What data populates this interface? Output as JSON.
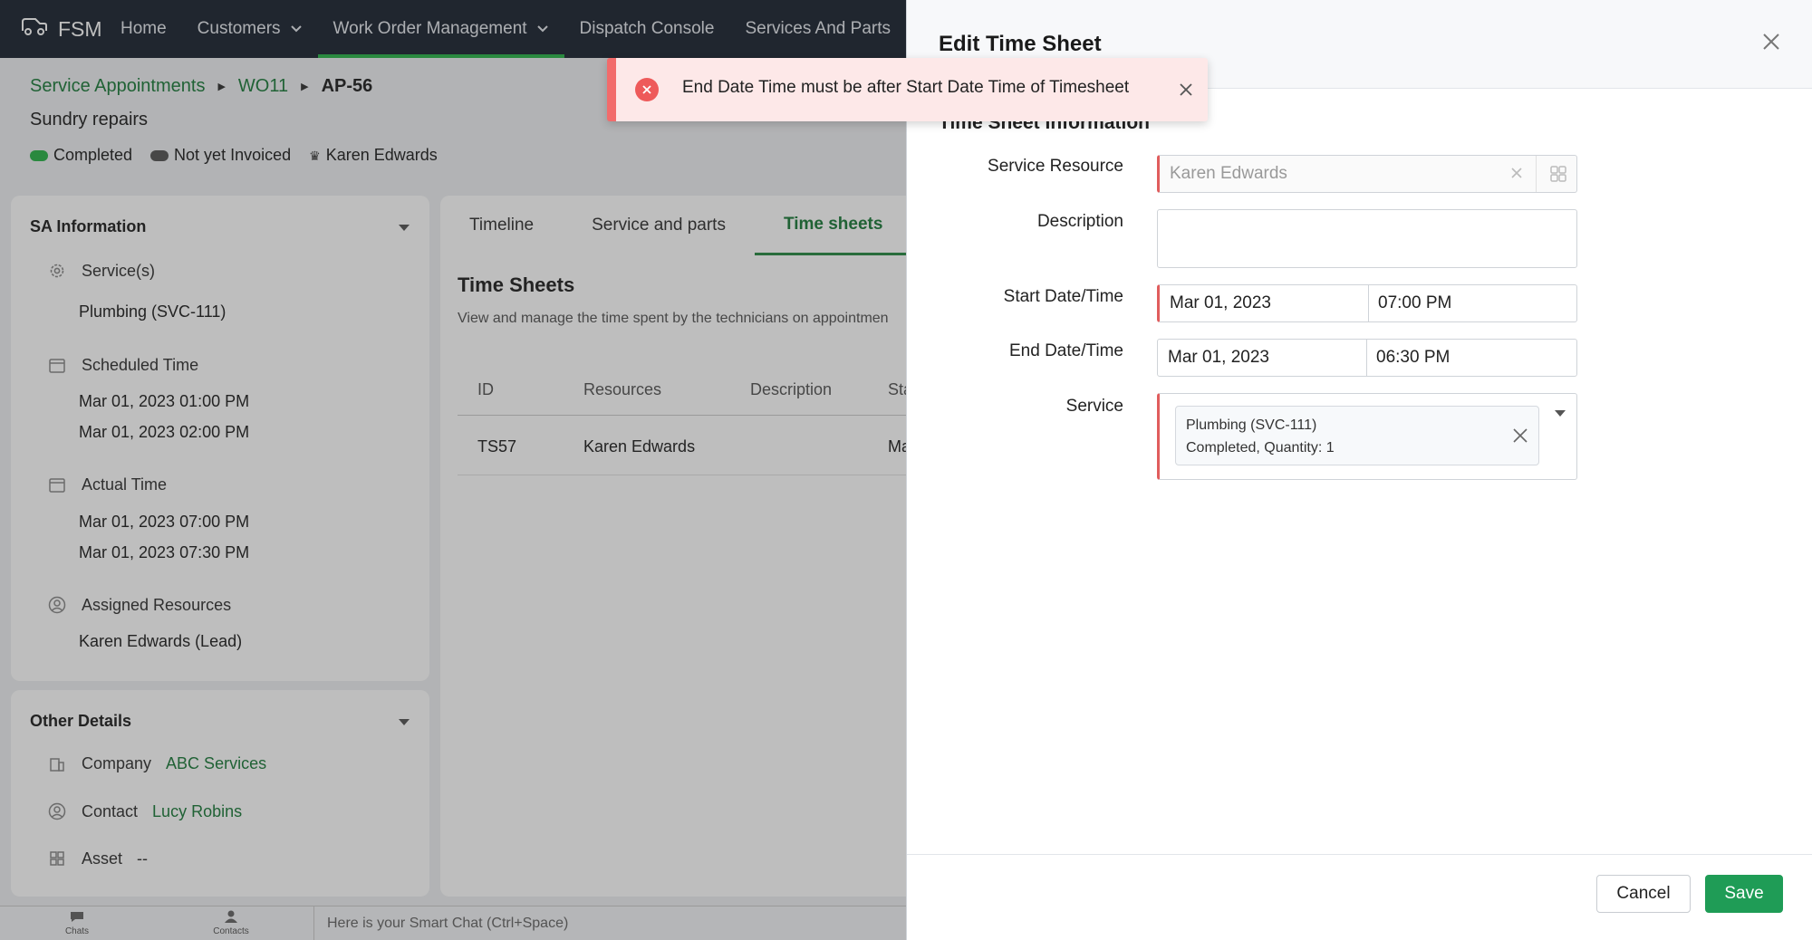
{
  "nav": {
    "brand": "FSM",
    "items": [
      {
        "label": "Home"
      },
      {
        "label": "Customers"
      },
      {
        "label": "Work Order Management"
      },
      {
        "label": "Dispatch Console"
      },
      {
        "label": "Services And Parts"
      }
    ]
  },
  "breadcrumb": {
    "items": [
      "Service Appointments",
      "WO11"
    ],
    "current": "AP-56"
  },
  "appointment": {
    "subtitle": "Sundry repairs",
    "status": "Completed",
    "invoice_status": "Not yet Invoiced",
    "lead": "Karen Edwards",
    "status_color": "#2bb34a",
    "invoice_color": "#555555"
  },
  "sa_info": {
    "title": "SA Information",
    "services_label": "Service(s)",
    "services_value": "Plumbing (SVC-111)",
    "scheduled_label": "Scheduled Time",
    "scheduled_start": "Mar 01, 2023 01:00 PM",
    "scheduled_end": "Mar 01, 2023 02:00 PM",
    "actual_label": "Actual Time",
    "actual_start": "Mar 01, 2023 07:00 PM",
    "actual_end": "Mar 01, 2023 07:30 PM",
    "resources_label": "Assigned Resources",
    "resources_value": "Karen Edwards (Lead)"
  },
  "other_details": {
    "title": "Other Details",
    "company_label": "Company",
    "company_value": "ABC Services",
    "contact_label": "Contact",
    "contact_value": "Lucy Robins",
    "asset_label": "Asset",
    "asset_value": "--"
  },
  "tabs": [
    {
      "label": "Timeline"
    },
    {
      "label": "Service and parts"
    },
    {
      "label": "Time sheets"
    }
  ],
  "timesheets": {
    "title": "Time Sheets",
    "description": "View and manage the time spent by the technicians on appointmen",
    "columns": [
      "ID",
      "Resources",
      "Description",
      "Sta"
    ],
    "rows": [
      {
        "id": "TS57",
        "resource": "Karen Edwards",
        "description": "",
        "status": "Ma"
      }
    ]
  },
  "bottombar": {
    "chats": "Chats",
    "contacts": "Contacts",
    "smart_chat": "Here is your Smart Chat (Ctrl+Space)"
  },
  "toast": {
    "message": "End Date Time must be after Start Date Time of Timesheet",
    "color": "#ee5a5a"
  },
  "drawer": {
    "title": "Edit Time Sheet",
    "section_title": "Time Sheet Information",
    "fields": {
      "service_resource_label": "Service Resource",
      "service_resource_value": "Karen Edwards",
      "description_label": "Description",
      "description_value": "",
      "start_label": "Start Date/Time",
      "start_date": "Mar 01, 2023",
      "start_time": "07:00 PM",
      "end_label": "End Date/Time",
      "end_date": "Mar 01, 2023",
      "end_time": "06:30 PM",
      "service_label": "Service",
      "service_chip_line1": "Plumbing (SVC-111)",
      "service_chip_line2": "Completed, Quantity: 1"
    },
    "cancel_label": "Cancel",
    "save_label": "Save",
    "accent": "#1f9c56"
  }
}
